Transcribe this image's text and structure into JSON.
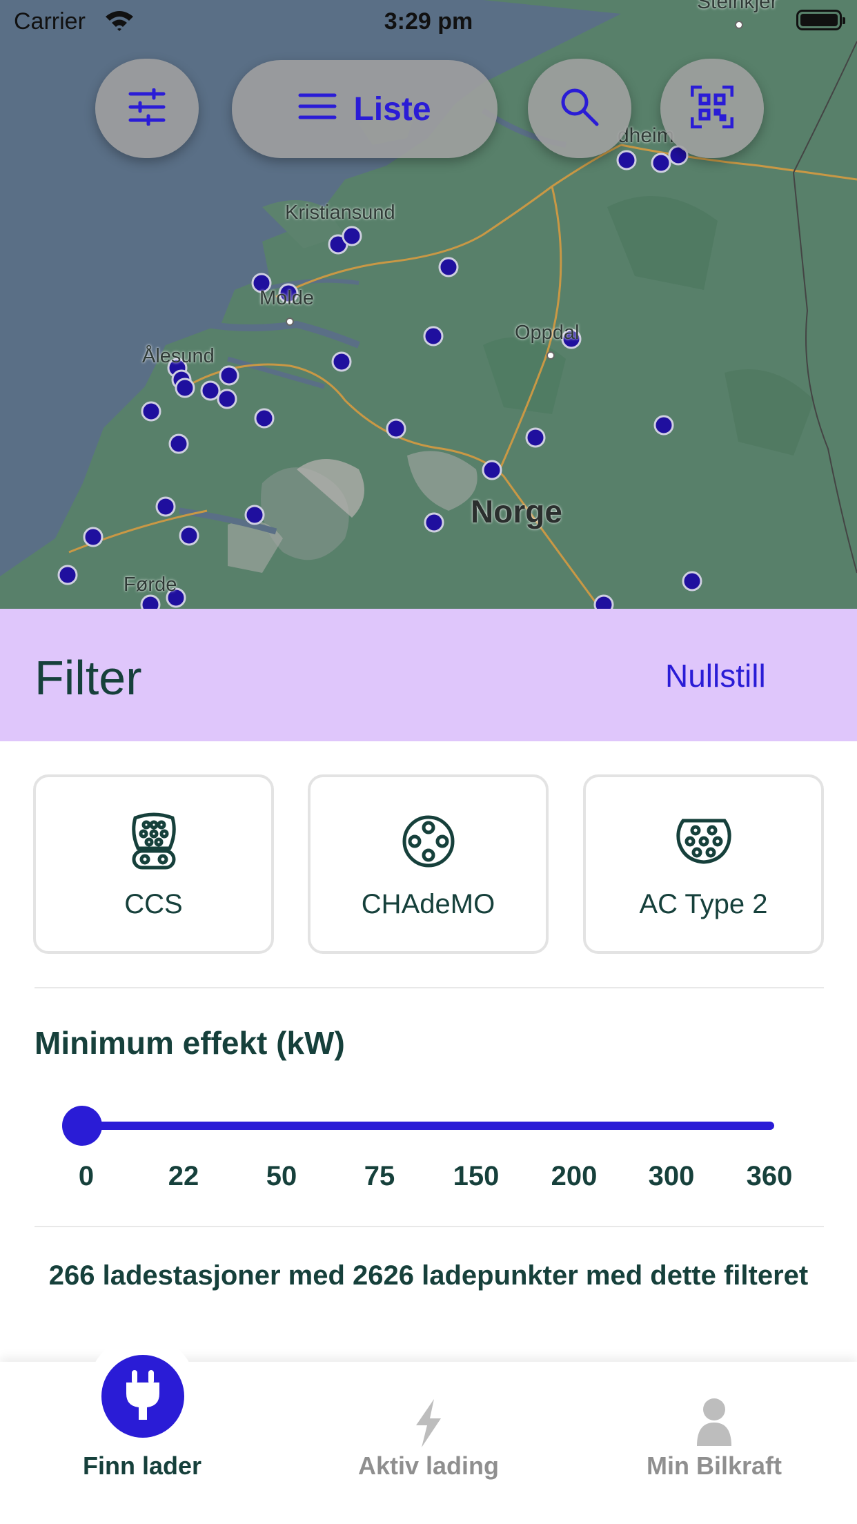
{
  "status_bar": {
    "carrier": "Carrier",
    "time": "3:29 pm"
  },
  "map": {
    "toolbar": {
      "list_button_label": "Liste",
      "filter_icon": "sliders-icon",
      "search_icon": "search-icon",
      "qr_icon": "qr-scan-icon"
    },
    "place_labels": {
      "steinkjer": "Steinkjer",
      "trondheim": "dheim",
      "kristiansund": "Kristiansund",
      "molde": "Molde",
      "oppdal": "Oppdal",
      "alesund": "Ålesund",
      "norge": "Norge",
      "forde": "Førde"
    },
    "marker_color": "#1f0f9e"
  },
  "filter": {
    "title": "Filter",
    "reset_label": "Nullstill",
    "connectors": [
      {
        "label": "CCS",
        "icon": "ccs-connector-icon"
      },
      {
        "label": "CHAdeMO",
        "icon": "chademo-connector-icon"
      },
      {
        "label": "AC Type 2",
        "icon": "type2-connector-icon"
      }
    ],
    "min_power": {
      "title": "Minimum effekt (kW)",
      "ticks": [
        "0",
        "22",
        "50",
        "75",
        "150",
        "200",
        "300",
        "360"
      ],
      "selected_value": 0
    },
    "result_text": "266 ladestasjoner med 2626 ladepunkter med dette filteret"
  },
  "tabbar": {
    "tabs": [
      {
        "label": "Finn lader",
        "icon": "plug-icon",
        "active": true
      },
      {
        "label": "Aktiv lading",
        "icon": "lightning-icon",
        "active": false
      },
      {
        "label": "Min Bilkraft",
        "icon": "person-icon",
        "active": false
      }
    ]
  },
  "colors": {
    "accent": "#2a1cd6",
    "header_bg": "#dfc6fb",
    "text_dark": "#16403b"
  }
}
